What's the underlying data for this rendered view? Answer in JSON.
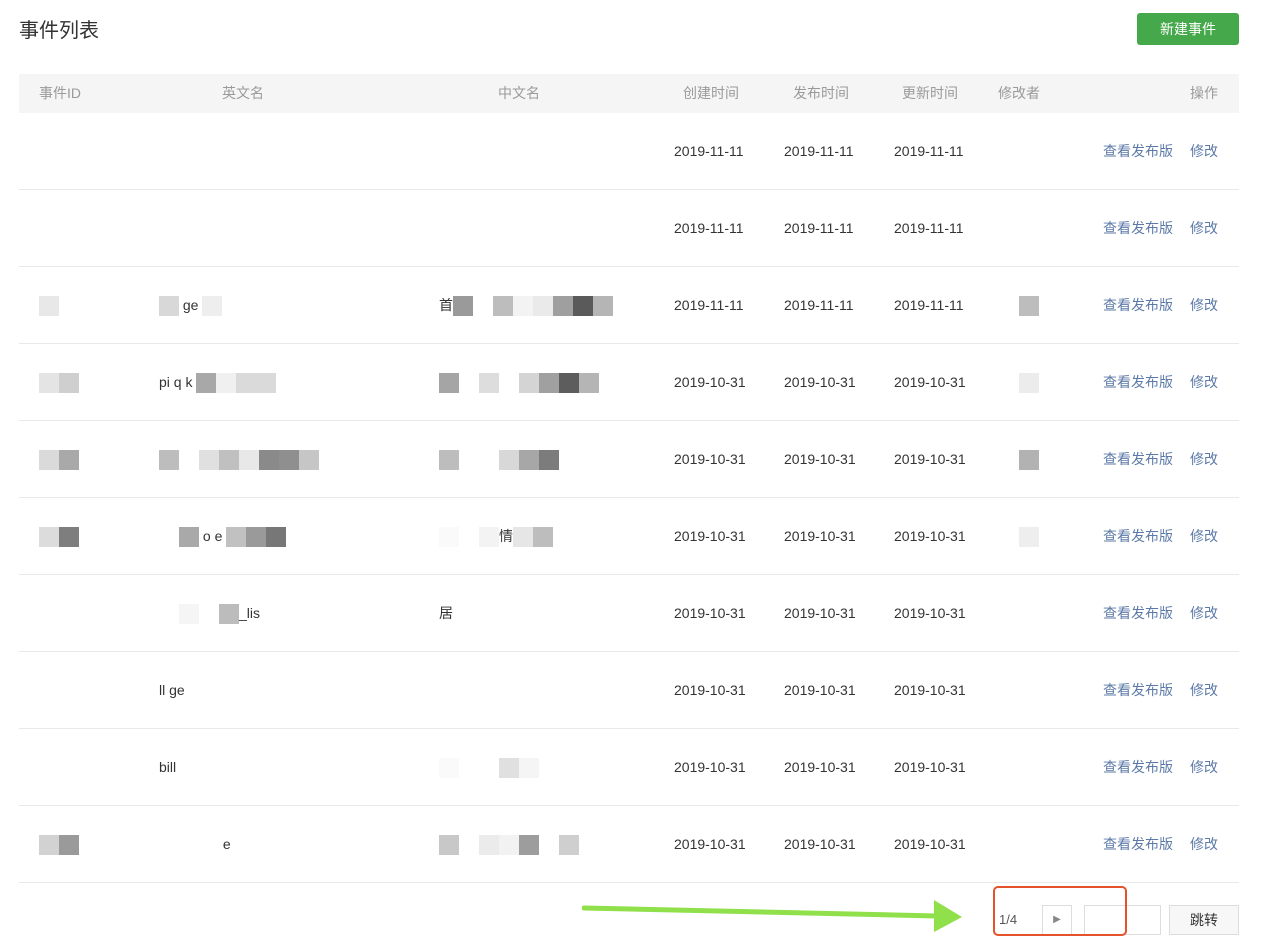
{
  "page": {
    "title": "事件列表",
    "new_button": "新建事件"
  },
  "table": {
    "headers": {
      "id": "事件ID",
      "en": "英文名",
      "cn": "中文名",
      "created": "创建时间",
      "published": "发布时间",
      "updated": "更新时间",
      "modifier": "修改者",
      "ops": "操作"
    },
    "rows": [
      {
        "en": "",
        "cn": "",
        "created": "2019-11-11",
        "published": "2019-11-11",
        "updated": "2019-11-11",
        "view": "查看发布版",
        "edit": "修改"
      },
      {
        "en": "",
        "cn": "",
        "created": "2019-11-11",
        "published": "2019-11-11",
        "updated": "2019-11-11",
        "view": "查看发布版",
        "edit": "修改"
      },
      {
        "en": "ge",
        "cn": "首",
        "created": "2019-11-11",
        "published": "2019-11-11",
        "updated": "2019-11-11",
        "view": "查看发布版",
        "edit": "修改"
      },
      {
        "en": "pi q k",
        "cn": "",
        "created": "2019-10-31",
        "published": "2019-10-31",
        "updated": "2019-10-31",
        "view": "查看发布版",
        "edit": "修改"
      },
      {
        "en": "",
        "cn": "",
        "created": "2019-10-31",
        "published": "2019-10-31",
        "updated": "2019-10-31",
        "view": "查看发布版",
        "edit": "修改"
      },
      {
        "en": "o e",
        "cn": "情",
        "created": "2019-10-31",
        "published": "2019-10-31",
        "updated": "2019-10-31",
        "view": "查看发布版",
        "edit": "修改"
      },
      {
        "en": "_lis",
        "cn": "居",
        "created": "2019-10-31",
        "published": "2019-10-31",
        "updated": "2019-10-31",
        "view": "查看发布版",
        "edit": "修改"
      },
      {
        "en": "ll ge",
        "cn": "",
        "created": "2019-10-31",
        "published": "2019-10-31",
        "updated": "2019-10-31",
        "view": "查看发布版",
        "edit": "修改"
      },
      {
        "en": "bill",
        "cn": "",
        "created": "2019-10-31",
        "published": "2019-10-31",
        "updated": "2019-10-31",
        "view": "查看发布版",
        "edit": "修改"
      },
      {
        "en": "e",
        "cn": "",
        "created": "2019-10-31",
        "published": "2019-10-31",
        "updated": "2019-10-31",
        "view": "查看发布版",
        "edit": "修改"
      }
    ]
  },
  "pagination": {
    "page_text": "1/4",
    "next_icon": "triangle-right-icon",
    "jump_input_value": "",
    "jump_button": "跳转"
  },
  "colors": {
    "primary_button": "#45a84a",
    "link": "#5c7aa8",
    "header_bg": "#f5f5f5",
    "annotation_box": "#e5532d",
    "annotation_arrow": "#8fe04a"
  }
}
